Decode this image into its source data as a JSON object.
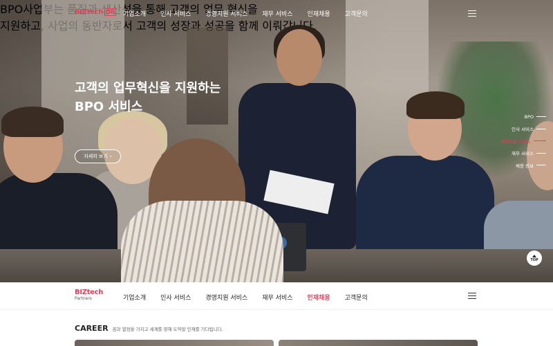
{
  "brand": {
    "logo_top_main": "BIZtech",
    "logo_top_suffix": "ON",
    "logo_bottom_main": "BIZtech",
    "logo_bottom_sub": "Partners",
    "accent_color": "#e63d58"
  },
  "nav": {
    "items": [
      "기업소개",
      "인사 서비스",
      "경영지원 서비스",
      "재무 서비스",
      "인재채용",
      "고객문의"
    ],
    "active_bottom_index": 4,
    "menu_icon": "hamburger-icon"
  },
  "hero": {
    "title_line1": "고객의 업무혁신을 지원하는",
    "title_line2": "BPO 서비스",
    "desc_line1": "BPO사업부는 품질과 생산성을 통해 고객의 업무 혁신을",
    "desc_line2": "지원하고, 사업의 동반자로서 고객의 성장과 성공을 함께 이뤄갑니다.",
    "more_label": "자세히 보기",
    "more_icon": "chevron-right-icon"
  },
  "indicator": {
    "items": [
      "BPO",
      "인사 서비스",
      "경영지원 서비스",
      "재무 서비스",
      "채용 정보"
    ],
    "active_index": 2
  },
  "top_button": {
    "label": "TOP",
    "icon": "arrow-up-icon"
  },
  "career": {
    "title": "CAREER",
    "subtitle": "꿈과 열정을 가지고 세계를 향해 도약할 인재를 기다립니다."
  }
}
